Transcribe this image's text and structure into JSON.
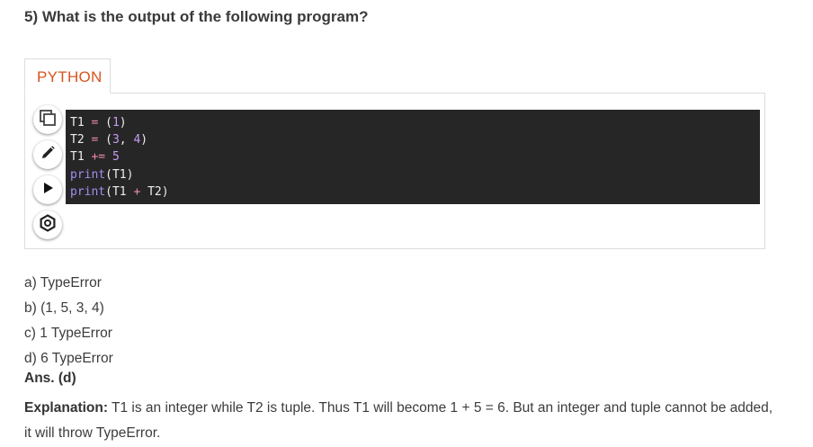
{
  "question": {
    "text": "5) What is the output of the following program?"
  },
  "code_panel": {
    "language_tab": "PYTHON",
    "tools": [
      {
        "name": "copy-icon"
      },
      {
        "name": "pencil-icon"
      },
      {
        "name": "play-icon"
      },
      {
        "name": "gear-icon"
      }
    ],
    "lines": [
      [
        {
          "t": "var",
          "s": "T1 "
        },
        {
          "t": "op",
          "s": "="
        },
        {
          "t": "var",
          "s": " ("
        },
        {
          "t": "num",
          "s": "1"
        },
        {
          "t": "var",
          "s": ")"
        }
      ],
      [
        {
          "t": "var",
          "s": "T2 "
        },
        {
          "t": "op",
          "s": "="
        },
        {
          "t": "var",
          "s": " ("
        },
        {
          "t": "num",
          "s": "3"
        },
        {
          "t": "var",
          "s": ", "
        },
        {
          "t": "num",
          "s": "4"
        },
        {
          "t": "var",
          "s": ")"
        }
      ],
      [
        {
          "t": "var",
          "s": "T1 "
        },
        {
          "t": "op",
          "s": "+="
        },
        {
          "t": "var",
          "s": " "
        },
        {
          "t": "num",
          "s": "5"
        }
      ],
      [
        {
          "t": "fn",
          "s": "print"
        },
        {
          "t": "var",
          "s": "(T1)"
        }
      ],
      [
        {
          "t": "fn",
          "s": "print"
        },
        {
          "t": "var",
          "s": "(T1 "
        },
        {
          "t": "op",
          "s": "+"
        },
        {
          "t": "var",
          "s": " T2)"
        }
      ]
    ]
  },
  "options": {
    "a": "a) TypeError",
    "b": "b) (1, 5, 3, 4)",
    "c": "c) 1 TypeError",
    "d": "d) 6 TypeError"
  },
  "answer": {
    "text": "Ans. (d)"
  },
  "explanation": {
    "label": "Explanation:",
    "text": " T1 is an integer while T2 is tuple. Thus T1 will become 1 + 5 = 6. But an integer and tuple cannot be added, it will throw TypeError."
  },
  "colors": {
    "tab_accent": "#d9531e",
    "code_background": "#262626",
    "operator": "#f08ba8",
    "number": "#c79cf5",
    "builtin": "#a58cf0"
  }
}
